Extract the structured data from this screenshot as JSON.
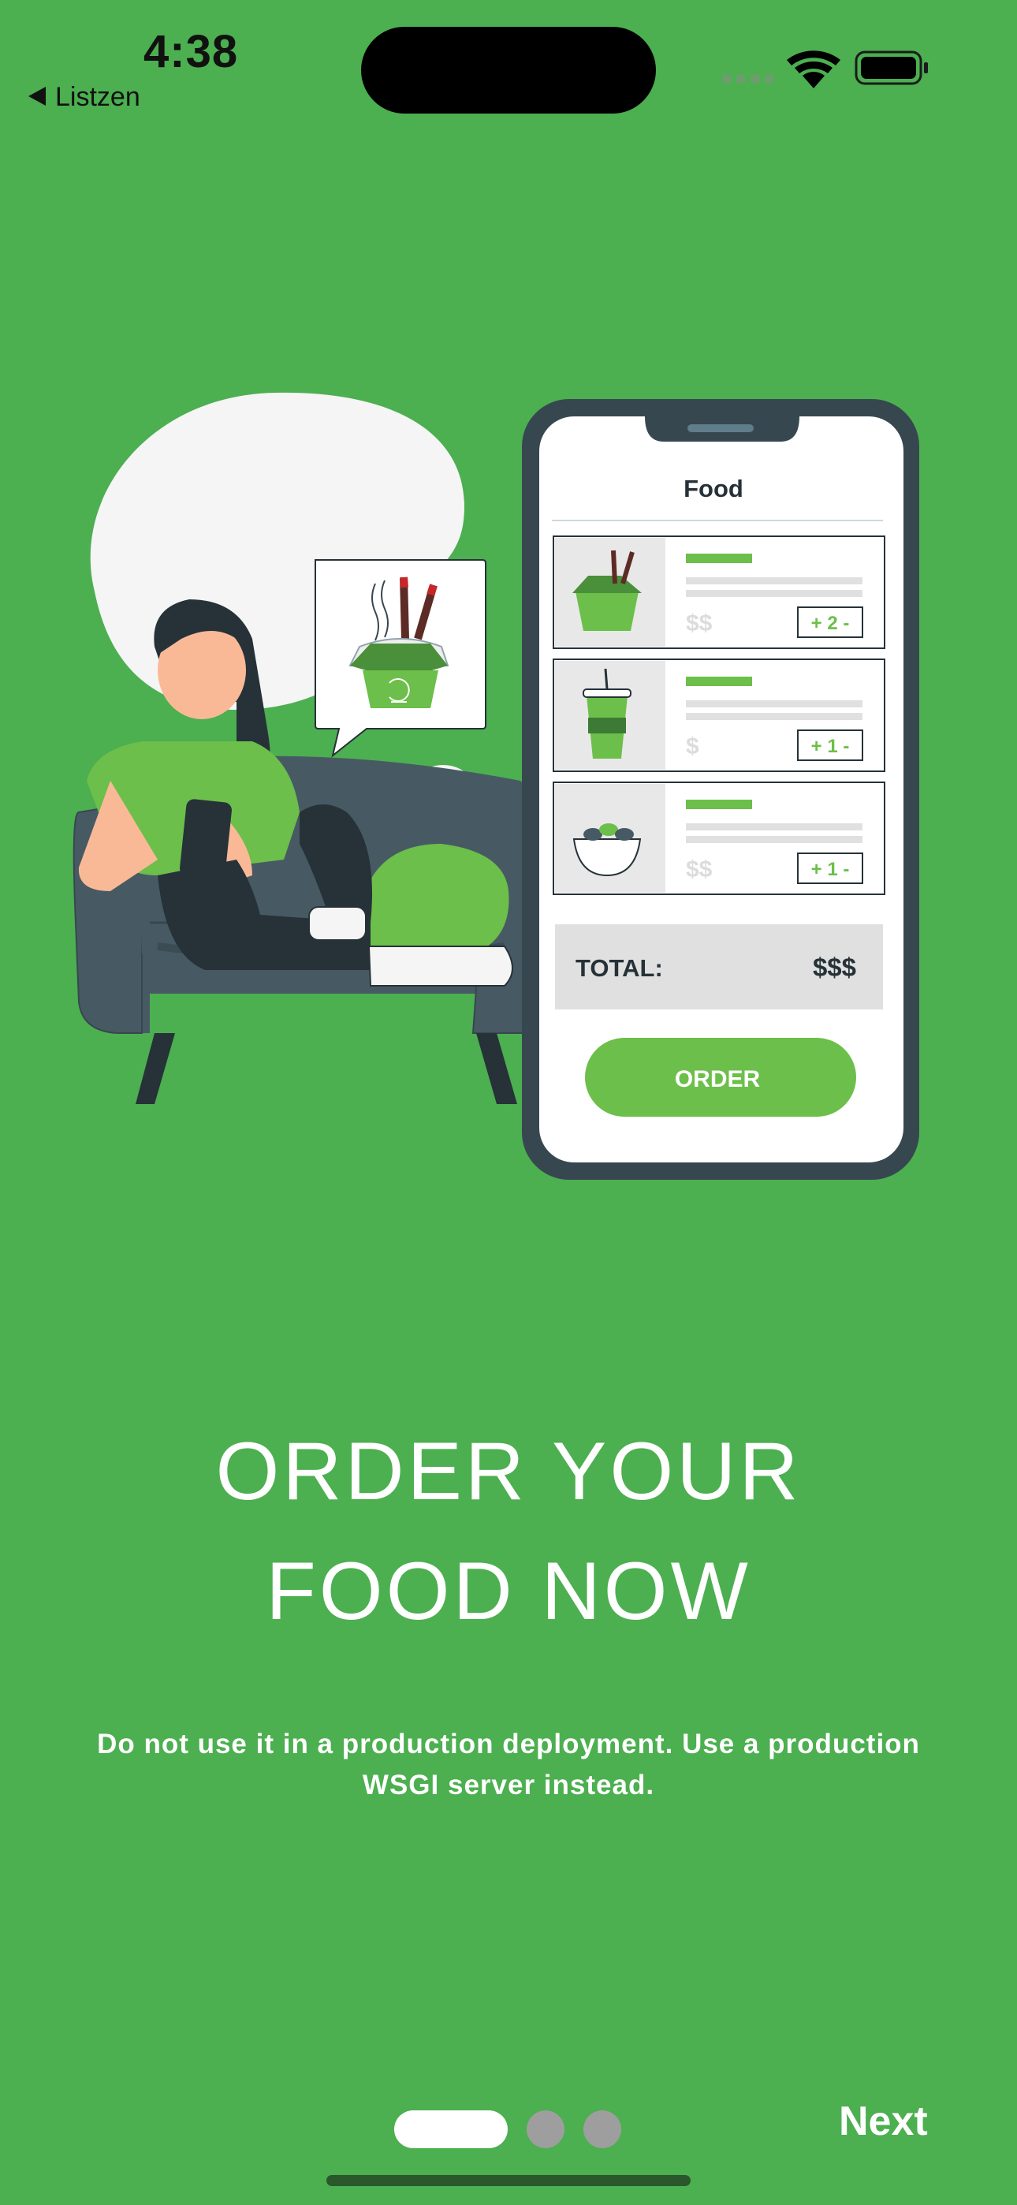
{
  "status_bar": {
    "time": "4:38",
    "back_label": "Listzen"
  },
  "illustration": {
    "phone_title": "Food",
    "items": [
      {
        "price": "$$",
        "qty": "+ 2 -"
      },
      {
        "price": "$",
        "qty": "+ 1 -"
      },
      {
        "price": "$$",
        "qty": "+ 1 -"
      }
    ],
    "total_label": "TOTAL:",
    "total_value": "$$$",
    "order_label": "ORDER"
  },
  "onboarding": {
    "headline_line1": "ORDER YOUR",
    "headline_line2": "FOOD NOW",
    "subtitle": "Do not use it in a production deployment. Use a production WSGI server instead.",
    "next_label": "Next",
    "page_count": 3,
    "current_page": 1
  },
  "colors": {
    "background": "#4caf50",
    "accent_green": "#6cbf4a",
    "dark": "#263238"
  }
}
